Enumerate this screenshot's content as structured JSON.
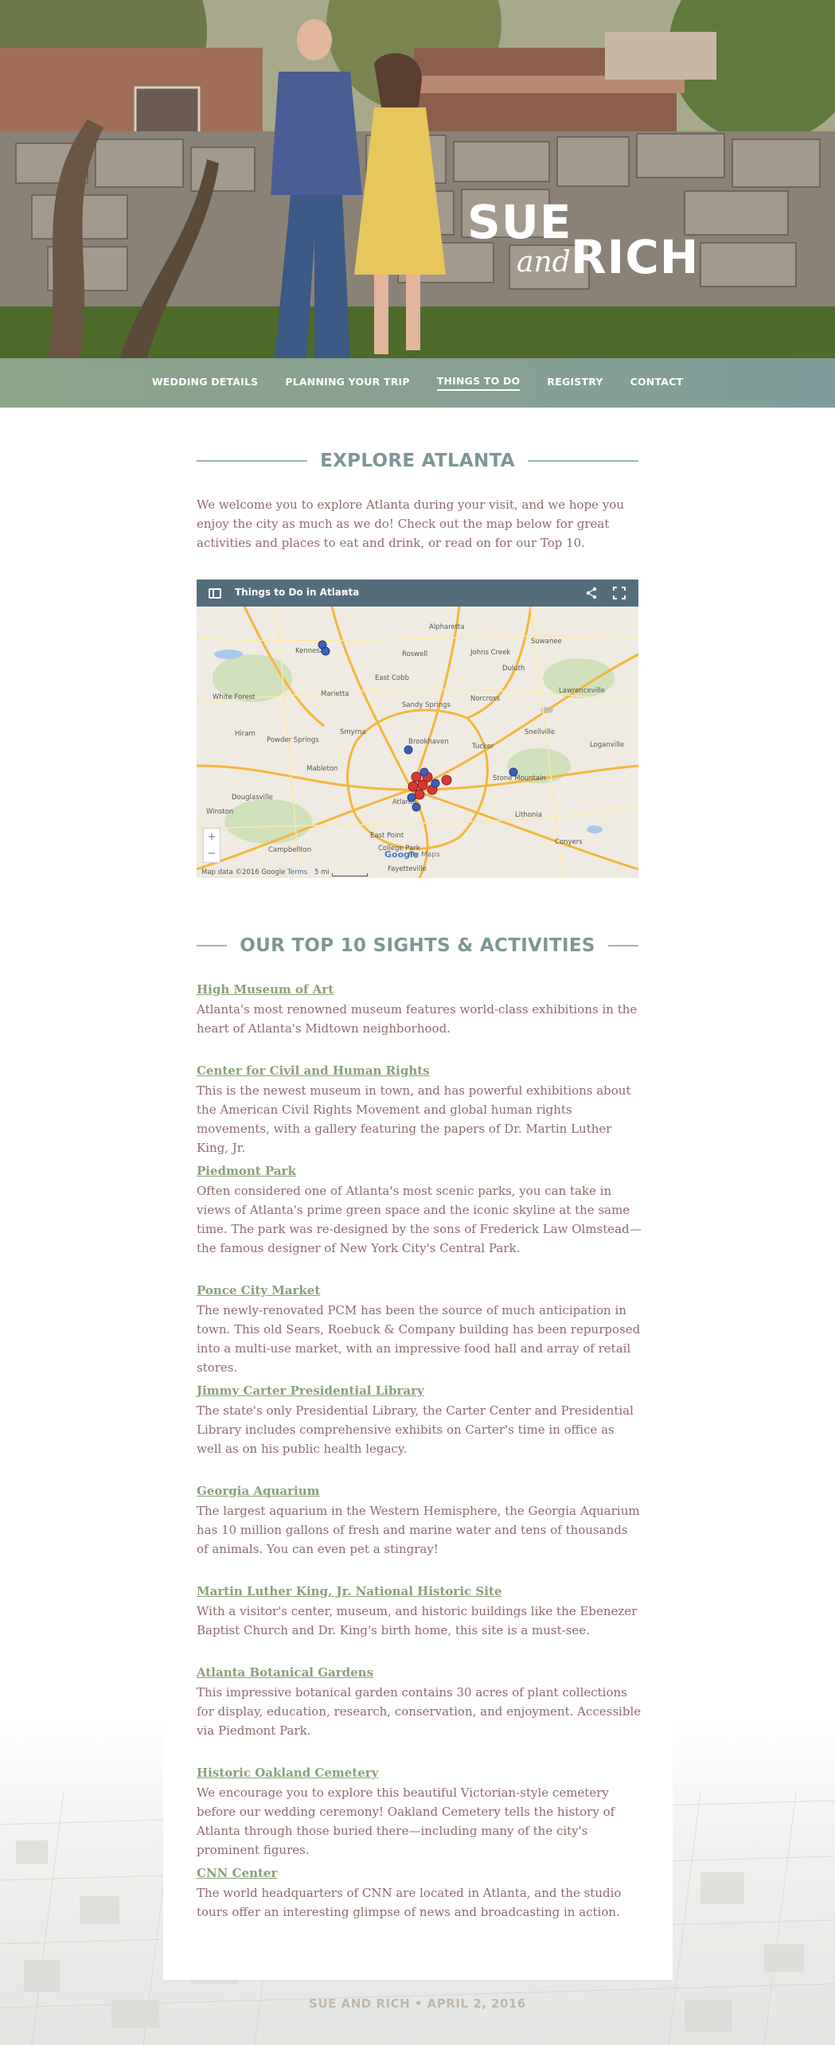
{
  "hero": {
    "logo_line1": "SUE",
    "logo_and": "and",
    "logo_line2": "RICH"
  },
  "nav": {
    "items": [
      {
        "label": "WEDDING DETAILS"
      },
      {
        "label": "PLANNING YOUR TRIP"
      },
      {
        "label": "THINGS TO DO",
        "active": true
      },
      {
        "label": "REGISTRY"
      },
      {
        "label": "CONTACT"
      }
    ]
  },
  "explore": {
    "heading": "EXPLORE ATLANTA",
    "intro": "We welcome you to explore Atlanta during your visit, and we hope you enjoy the city as much as we do! Check out the map below for great activities and places to eat and drink, or read on for our Top 10."
  },
  "map": {
    "title": "Things to Do in Atlanta",
    "zoom_in": "+",
    "zoom_out": "−",
    "credit": "Map data ©2016 Google",
    "terms": "Terms",
    "scale": "5 mi",
    "google": "Google",
    "my_maps": "My Maps",
    "labels": [
      "Alpharetta",
      "Johns Creek",
      "Roswell",
      "Suwanee",
      "Kennesaw",
      "Duluth",
      "Marietta",
      "East Cobb",
      "Norcross",
      "Lawrenceville",
      "White Forest",
      "Sandy Springs",
      "Smyrna",
      "Tucker",
      "Hiram",
      "Powder Springs",
      "Brookhaven",
      "Snellville",
      "Mableton",
      "Stone Mountain",
      "Loganville",
      "Atlanta",
      "Douglasville",
      "Lithonia",
      "East Point",
      "Winston",
      "College Park",
      "Conyers",
      "Campbellton",
      "Fayetteville"
    ],
    "colors": {
      "pin_blue": "#3d5fb8",
      "pin_red": "#d63a34",
      "road": "#f4b63d",
      "water": "#a9c8ea"
    }
  },
  "top10": {
    "heading": "OUR TOP 10 SIGHTS & ACTIVITIES",
    "items": [
      {
        "title": "High Museum of Art",
        "desc": "Atlanta's most renowned museum features world-class exhibitions in the heart of Atlanta's Midtown neighborhood."
      },
      {
        "title": "Center for Civil and Human Rights",
        "desc": "This is the newest museum in town, and has powerful exhibitions about the American Civil Rights Movement and global human rights movements, with a gallery featuring the papers of Dr. Martin Luther King, Jr."
      },
      {
        "title": "Piedmont Park",
        "desc": "Often considered one of Atlanta's most scenic parks, you can take in views of Atlanta's prime green space and the iconic skyline at the same time. The park was re-designed by the sons of Frederick Law Olmstead—the famous designer of New York City's Central Park."
      },
      {
        "title": "Ponce City Market",
        "desc": "The newly-renovated PCM has been the source of much anticipation in town. This old Sears, Roebuck & Company building has been repurposed into a multi-use market, with an impressive food hall and array of retail stores."
      },
      {
        "title": "Jimmy Carter Presidential Library",
        "desc": "The state's only Presidential Library, the Carter Center and Presidential Library includes comprehensive exhibits on Carter's time in office as well as on his public health legacy."
      },
      {
        "title": "Georgia Aquarium",
        "desc": "The largest aquarium in the Western Hemisphere, the Georgia Aquarium has 10 million gallons of fresh and marine water and tens of thousands of animals. You can even pet a stingray!"
      },
      {
        "title": "Martin Luther King, Jr. National Historic Site",
        "desc": "With a visitor's center, museum, and historic buildings like the Ebenezer Baptist Church and Dr. King's birth home, this site is a must-see."
      },
      {
        "title": "Atlanta Botanical Gardens",
        "desc": "This impressive botanical garden contains 30 acres of plant collections for display, education, research, conservation, and enjoyment. Accessible via Piedmont Park."
      },
      {
        "title": "Historic Oakland Cemetery",
        "desc": "We encourage you to explore this beautiful Victorian-style cemetery before our wedding ceremony! Oakland Cemetery tells the history of Atlanta through those buried there—including many of the city's prominent figures."
      },
      {
        "title": "CNN Center",
        "desc": "The world headquarters of CNN are located in Atlanta, and the studio tours offer an interesting glimpse of news and broadcasting in action."
      }
    ]
  },
  "footer": {
    "text": "SUE AND RICH • APRIL 2, 2016"
  }
}
